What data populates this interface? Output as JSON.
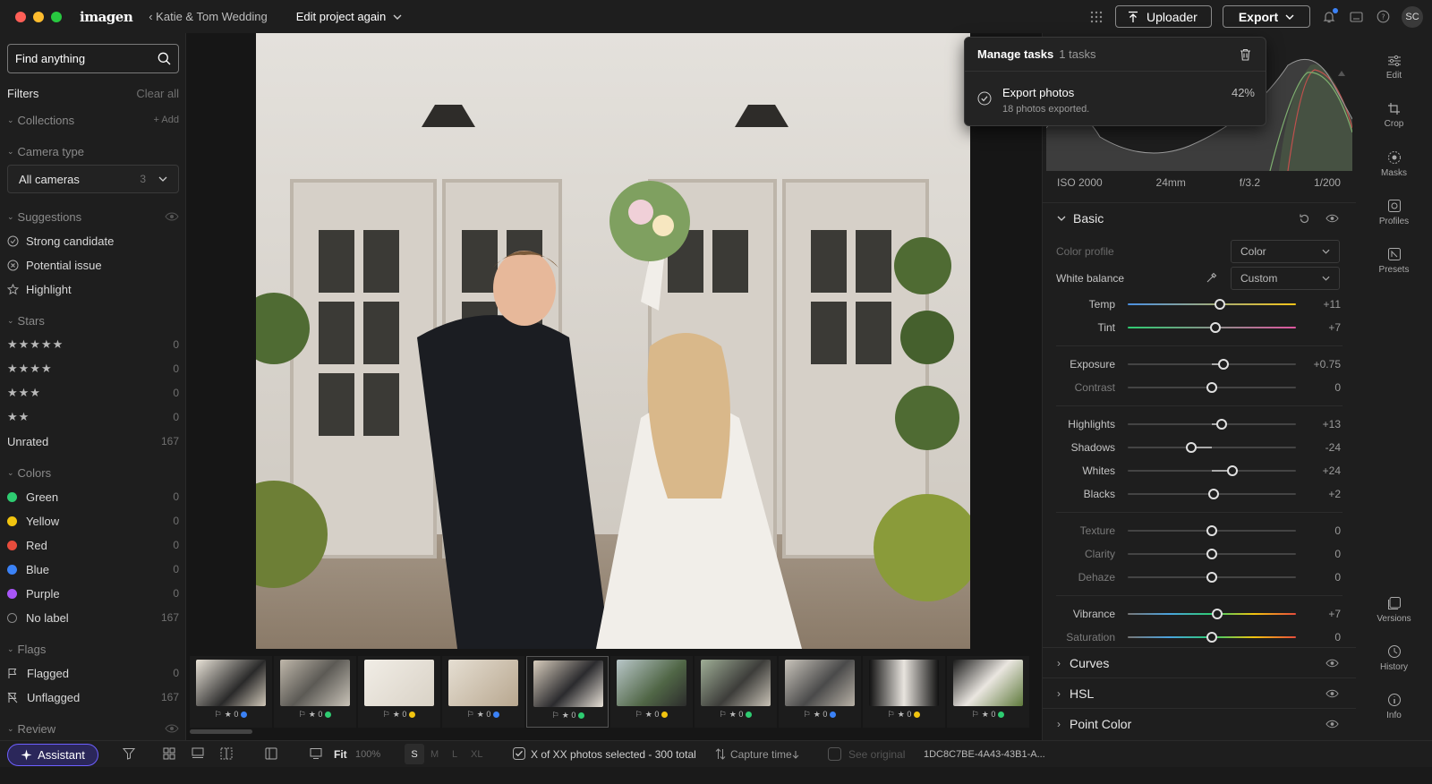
{
  "app": {
    "logo": "imagen",
    "breadcrumb": "‹ Katie & Tom Wedding",
    "project": "Edit project again"
  },
  "top": {
    "uploader": "Uploader",
    "export": "Export",
    "avatar": "SC"
  },
  "left": {
    "search_placeholder": "Find anything",
    "filters": "Filters",
    "clear_all": "Clear all",
    "collections": "Collections",
    "add": "+ Add",
    "camera_type": "Camera type",
    "camera_select": "All cameras",
    "camera_count": "3",
    "suggestions": "Suggestions",
    "suggestion_items": [
      "Strong candidate",
      "Potential issue",
      "Highlight"
    ],
    "stars_title": "Stars",
    "stars": [
      {
        "label": "★★★★★",
        "count": "0"
      },
      {
        "label": "★★★★",
        "count": "0"
      },
      {
        "label": "★★★",
        "count": "0"
      },
      {
        "label": "★★",
        "count": "0"
      },
      {
        "label": "Unrated",
        "count": "167"
      }
    ],
    "colors_title": "Colors",
    "colors": [
      {
        "label": "Green",
        "count": "0",
        "color": "#2ecc71"
      },
      {
        "label": "Yellow",
        "count": "0",
        "color": "#f1c40f"
      },
      {
        "label": "Red",
        "count": "0",
        "color": "#e74c3c"
      },
      {
        "label": "Blue",
        "count": "0",
        "color": "#3b82f6"
      },
      {
        "label": "Purple",
        "count": "0",
        "color": "#a855f7"
      },
      {
        "label": "No label",
        "count": "167",
        "color": ""
      }
    ],
    "flags_title": "Flags",
    "flags": [
      {
        "label": "Flagged",
        "count": "0"
      },
      {
        "label": "Unflagged",
        "count": "167"
      }
    ],
    "review": "Review"
  },
  "popup": {
    "title": "Manage tasks",
    "count": "1 tasks",
    "task": "Export photos",
    "task_sub": "18 photos exported.",
    "progress": "42%"
  },
  "exif": {
    "iso": "ISO 2000",
    "focal": "24mm",
    "aperture": "f/3.2",
    "shutter": "1/200"
  },
  "basic": {
    "title": "Basic",
    "color_profile_label": "Color profile",
    "color_profile": "Color",
    "white_balance_label": "White balance",
    "white_balance": "Custom",
    "sliders": [
      {
        "label": "Temp",
        "value": "+11"
      },
      {
        "label": "Tint",
        "value": "+7"
      },
      {
        "label": "Exposure",
        "value": "+0.75"
      },
      {
        "label": "Contrast",
        "value": "0"
      },
      {
        "label": "Highlights",
        "value": "+13"
      },
      {
        "label": "Shadows",
        "value": "-24"
      },
      {
        "label": "Whites",
        "value": "+24"
      },
      {
        "label": "Blacks",
        "value": "+2"
      },
      {
        "label": "Texture",
        "value": "0"
      },
      {
        "label": "Clarity",
        "value": "0"
      },
      {
        "label": "Dehaze",
        "value": "0"
      },
      {
        "label": "Vibrance",
        "value": "+7"
      },
      {
        "label": "Saturation",
        "value": "0"
      }
    ]
  },
  "panels": [
    "Curves",
    "HSL",
    "Point Color"
  ],
  "tools": [
    "Edit",
    "Crop",
    "Masks",
    "Profiles",
    "Presets",
    "Versions",
    "History",
    "Info"
  ],
  "thumbs": [
    {
      "meta": "★ 0",
      "dot": "#3b82f6"
    },
    {
      "meta": "★ 0",
      "dot": "#2ecc71"
    },
    {
      "meta": "★ 0",
      "dot": "#f1c40f"
    },
    {
      "meta": "★ 0",
      "dot": "#3b82f6"
    },
    {
      "meta": "★ 0",
      "dot": "#2ecc71"
    },
    {
      "meta": "★ 0",
      "dot": "#f1c40f"
    },
    {
      "meta": "★ 0",
      "dot": "#2ecc71"
    },
    {
      "meta": "★ 0",
      "dot": "#3b82f6"
    },
    {
      "meta": "★ 0",
      "dot": "#f1c40f"
    },
    {
      "meta": "★ 0",
      "dot": "#2ecc71"
    }
  ],
  "bottom": {
    "assistant": "Assistant",
    "fit": "Fit",
    "zoom": "100%",
    "sizes": [
      "S",
      "M",
      "L",
      "XL"
    ],
    "selection": "X of XX photos selected - 300 total",
    "sort": "Capture time",
    "see_original": "See original",
    "id": "1DC8C7BE-4A43-43B1-A..."
  }
}
